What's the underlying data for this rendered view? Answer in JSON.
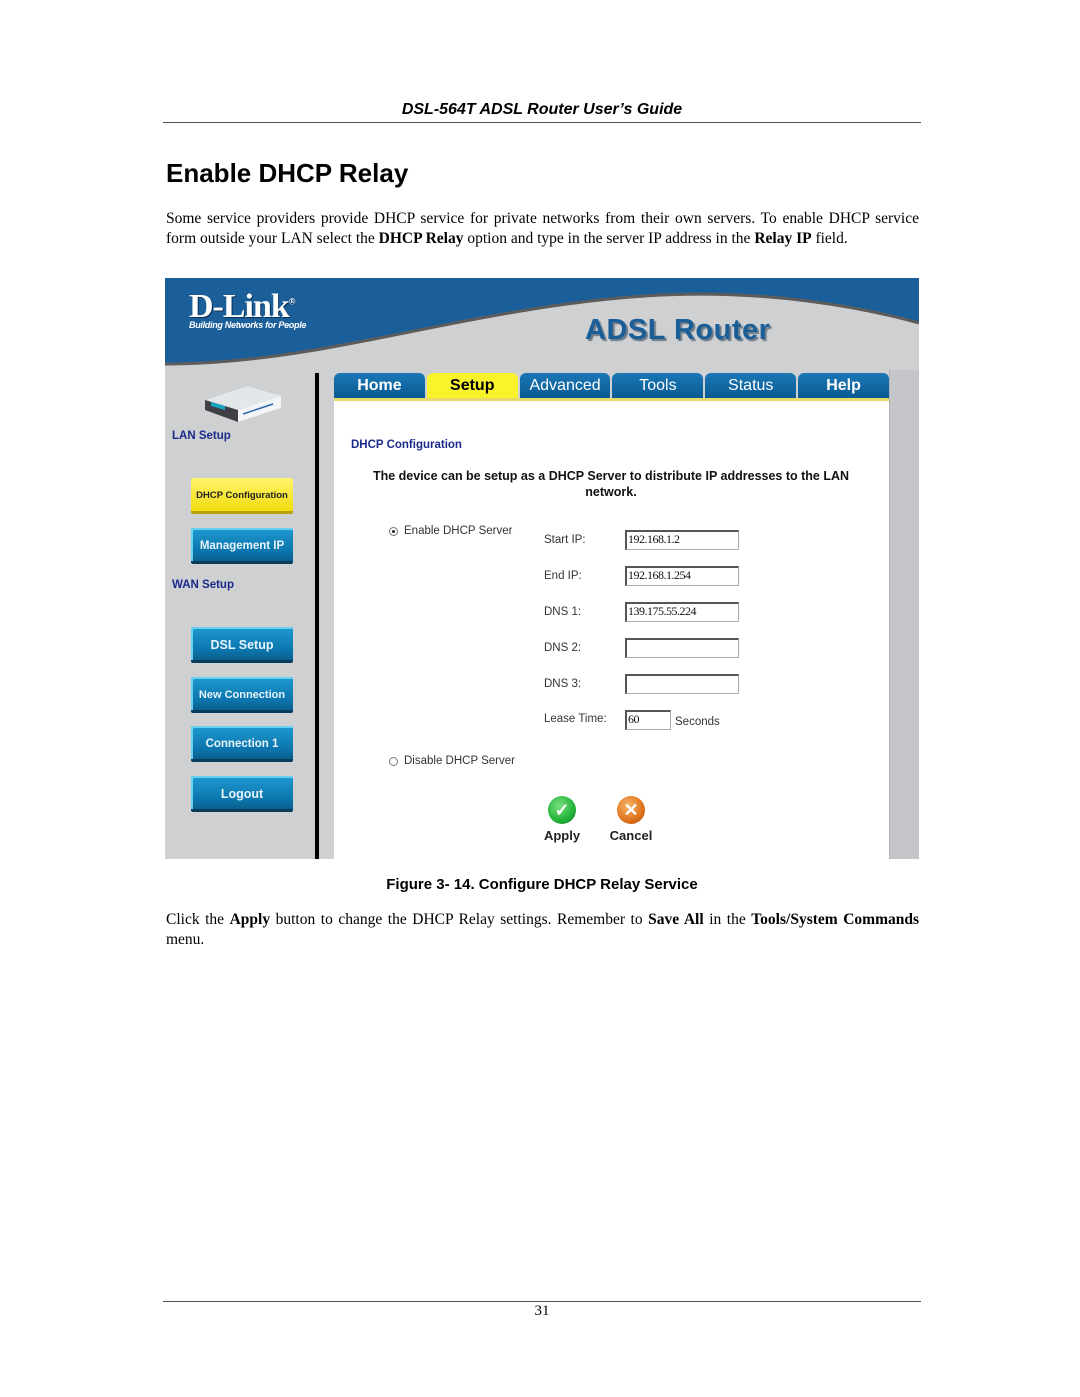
{
  "document": {
    "running_header": "DSL-564T ADSL Router User’s Guide",
    "section_title": "Enable DHCP Relay",
    "intro_paragraph": {
      "part1": "Some service providers provide DHCP service for private networks from their own servers. To enable DHCP service form outside your LAN select the ",
      "bold1": "DHCP Relay",
      "part2": " option and type in the server IP address in the ",
      "bold2": "Relay IP",
      "part3": " field."
    },
    "figure_caption": "Figure 3- 14. Configure DHCP Relay Service",
    "closing_paragraph": {
      "part1": "Click the ",
      "bold1": "Apply",
      "part2": " button to change the DHCP Relay settings. Remember to ",
      "bold2": "Save All",
      "part3": " in the ",
      "bold3": "Tools/System Commands",
      "part4": " menu."
    },
    "page_number": "31"
  },
  "router_ui": {
    "brand": {
      "logo": "D-Link",
      "registered": "®",
      "tagline": "Building Networks for People",
      "product": "ADSL Router"
    },
    "tabs": [
      {
        "label": "Home",
        "active": false
      },
      {
        "label": "Setup",
        "active": true
      },
      {
        "label": "Advanced",
        "active": false
      },
      {
        "label": "Tools",
        "active": false
      },
      {
        "label": "Status",
        "active": false
      },
      {
        "label": "Help",
        "active": false
      }
    ],
    "sidebar": {
      "lan_heading": "LAN Setup",
      "wan_heading": "WAN Setup",
      "buttons": [
        {
          "label": "DHCP Configuration",
          "active": true
        },
        {
          "label": "Management IP",
          "active": false
        },
        {
          "label": "DSL Setup",
          "active": false
        },
        {
          "label": "New Connection",
          "active": false
        },
        {
          "label": "Connection 1",
          "active": false
        },
        {
          "label": "Logout",
          "active": false
        }
      ]
    },
    "content": {
      "title": "DHCP Configuration",
      "description": "The device can be setup as a DHCP Server to distribute IP addresses to the LAN network.",
      "enable_option": {
        "label": "Enable DHCP Server",
        "selected": true
      },
      "disable_option": {
        "label": "Disable DHCP Server",
        "selected": false
      },
      "fields": [
        {
          "label": "Start IP:",
          "value": "192.168.1.2"
        },
        {
          "label": "End IP:",
          "value": "192.168.1.254"
        },
        {
          "label": "DNS 1:",
          "value": "139.175.55.224"
        },
        {
          "label": "DNS 2:",
          "value": ""
        },
        {
          "label": "DNS 3:",
          "value": ""
        },
        {
          "label": "Lease Time:",
          "value": "60",
          "unit": "Seconds"
        }
      ],
      "apply_label": "Apply",
      "cancel_label": "Cancel"
    },
    "colors": {
      "banner_blue": "#1b5f9a",
      "tab_blue": "#0a5a93",
      "tab_active": "#f8f32a",
      "heading_navy": "#1a2a8c",
      "apply_green": "#22b33a",
      "cancel_orange": "#e0731c"
    }
  }
}
